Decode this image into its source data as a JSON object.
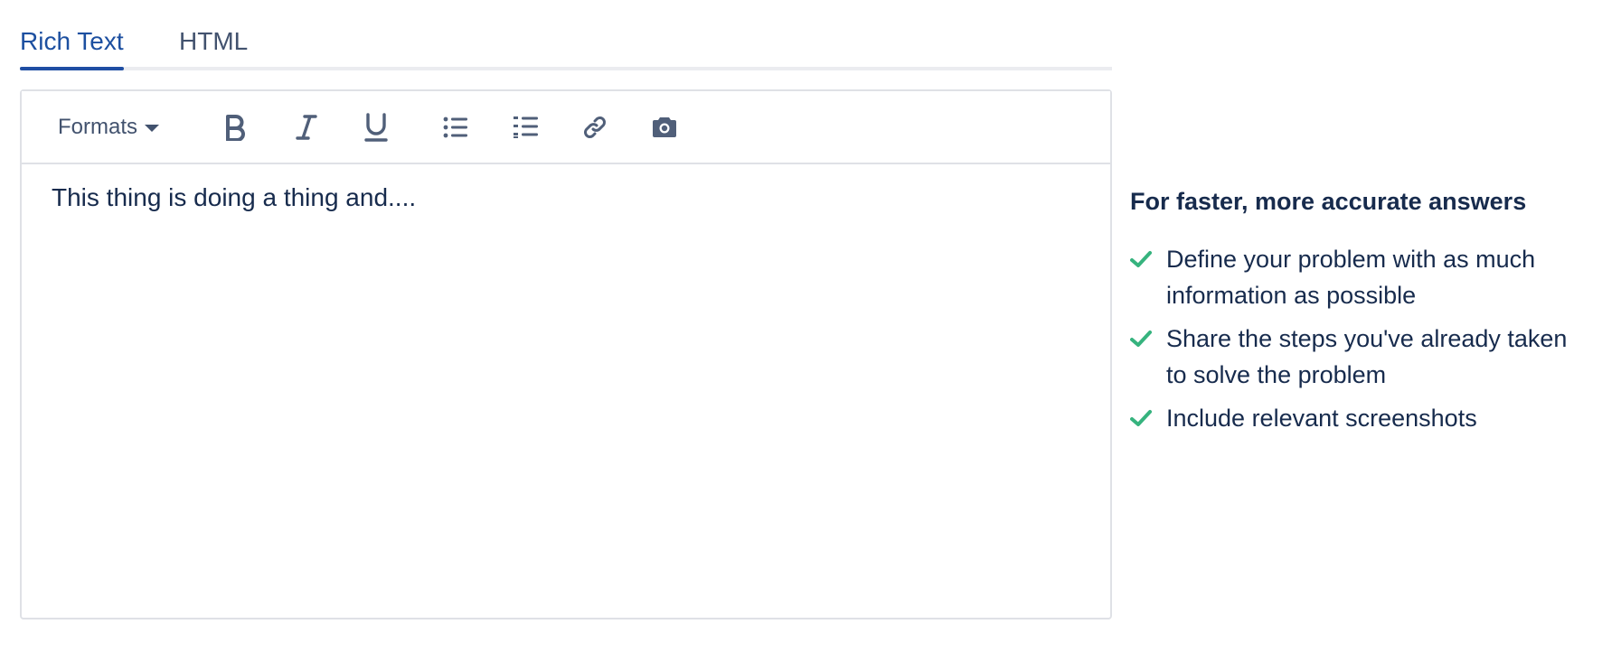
{
  "tabs": [
    {
      "label": "Rich Text",
      "active": true
    },
    {
      "label": "HTML",
      "active": false
    }
  ],
  "toolbar": {
    "formats_label": "Formats",
    "buttons": [
      "bold-icon",
      "italic-icon",
      "underline-icon",
      "bullet-list-icon",
      "numbered-list-icon",
      "link-icon",
      "camera-icon"
    ]
  },
  "editor": {
    "content": "This thing is doing a thing and...."
  },
  "tips": {
    "title": "For faster, more accurate answers",
    "items": [
      "Define your problem with as much information as possible",
      "Share the steps you've already taken to solve the problem",
      "Include relevant screenshots"
    ]
  },
  "colors": {
    "accent": "#1f4ea3",
    "text": "#172b4d",
    "muted": "#42526e",
    "border": "#dfe1e6",
    "check": "#36b37e"
  }
}
